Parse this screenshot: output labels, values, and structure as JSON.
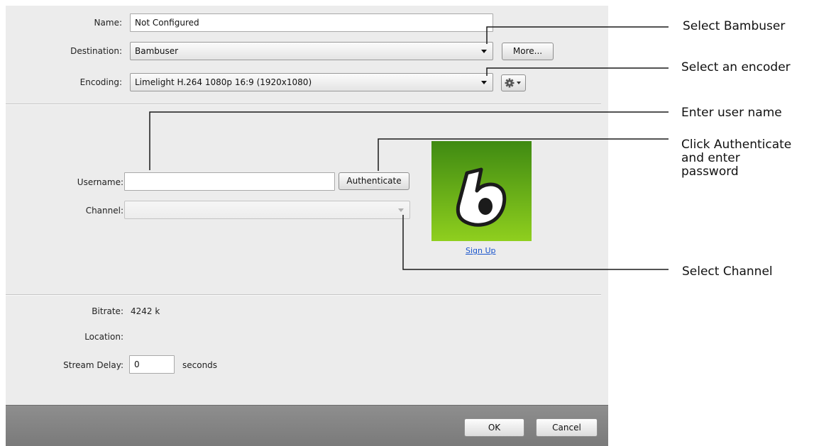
{
  "form": {
    "name_label": "Name:",
    "name_value": "Not Configured",
    "destination_label": "Destination:",
    "destination_value": "Bambuser",
    "more_button": "More...",
    "encoding_label": "Encoding:",
    "encoding_value": "Limelight H.264 1080p 16:9 (1920x1080)",
    "username_label": "Username:",
    "username_value": "",
    "authenticate_button": "Authenticate",
    "channel_label": "Channel:",
    "channel_value": "",
    "signup_link": "Sign Up",
    "bitrate_label": "Bitrate:",
    "bitrate_value": "4242 k",
    "location_label": "Location:",
    "location_value": "",
    "stream_delay_label": "Stream Delay:",
    "stream_delay_value": "0",
    "stream_delay_unit": "seconds"
  },
  "footer": {
    "ok_button": "OK",
    "cancel_button": "Cancel"
  },
  "callouts": {
    "select_bambuser": "Select Bambuser",
    "select_encoder": "Select an encoder",
    "enter_username": "Enter user name",
    "authenticate_line1": "Click Authenticate",
    "authenticate_line2": "and enter",
    "authenticate_line3": "password",
    "select_channel": "Select Channel"
  },
  "icons": {
    "gear": "gear-icon",
    "dropdown": "chevron-down-icon",
    "logo": "bambuser-logo"
  },
  "colors": {
    "logo_top": "#3f8a12",
    "logo_bottom": "#8fcf1e",
    "link": "#1a55cc"
  }
}
